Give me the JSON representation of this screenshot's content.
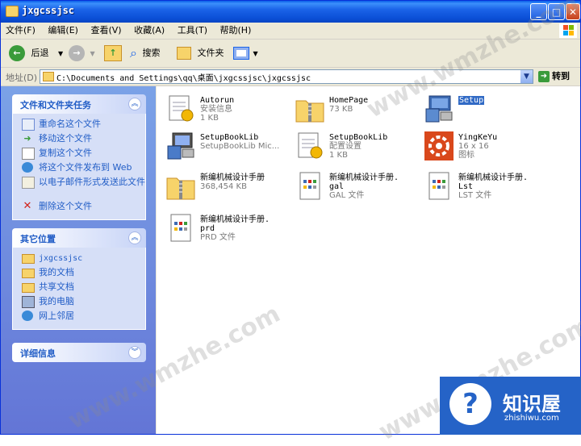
{
  "window": {
    "title": "jxgcssjsc",
    "controls": [
      "minimize",
      "maximize",
      "close"
    ]
  },
  "menu": [
    "文件(F)",
    "编辑(E)",
    "查看(V)",
    "收藏(A)",
    "工具(T)",
    "帮助(H)"
  ],
  "toolbar": {
    "back_label": "后退",
    "search_label": "搜索",
    "folders_label": "文件夹"
  },
  "address": {
    "label": "地址(D)",
    "value": "C:\\Documents and Settings\\qq\\桌面\\jxgcssjsc\\jxgcssjsc",
    "go_label": "转到"
  },
  "tasks": {
    "title": "文件和文件夹任务",
    "items": [
      "重命名这个文件",
      "移动这个文件",
      "复制这个文件",
      "将这个文件发布到 Web",
      "以电子邮件形式发送此文件",
      "删除这个文件"
    ]
  },
  "places": {
    "title": "其它位置",
    "items": [
      "jxgcssjsc",
      "我的文档",
      "共享文档",
      "我的电脑",
      "网上邻居"
    ]
  },
  "details": {
    "title": "详细信息"
  },
  "files": [
    {
      "name": "Autorun",
      "line2": "安装信息",
      "line3": "1 KB",
      "icon": "config-icon"
    },
    {
      "name": "HomePage",
      "line2": "73 KB",
      "icon": "zip-folder-icon"
    },
    {
      "name": "Setup",
      "icon": "installer-icon",
      "selected": true
    },
    {
      "name": "SetupBookLib",
      "line2": "SetupBookLib Mic...",
      "icon": "installer-icon"
    },
    {
      "name": "SetupBookLib",
      "line2": "配置设置",
      "line3": "1 KB",
      "icon": "config-icon"
    },
    {
      "name": "YingKeYu",
      "line2": "16 x 16",
      "line3": "图标",
      "icon": "gear-image-icon"
    },
    {
      "name": "新编机械设计手册",
      "line2": "368,454 KB",
      "icon": "zip-folder-icon"
    },
    {
      "name": "新编机械设计手册.",
      "name2": "gal",
      "line2": "GAL 文件",
      "icon": "document-icon"
    },
    {
      "name": "新编机械设计手册.",
      "name2": "Lst",
      "line2": "LST 文件",
      "icon": "document-icon"
    },
    {
      "name": "新编机械设计手册.",
      "name2": "prd",
      "line2": "PRD 文件",
      "icon": "document-icon"
    }
  ],
  "watermarks": [
    "www.wmzhe.com"
  ],
  "badge": {
    "glyph": "?",
    "title": "知识屋",
    "subtitle": "zhishiwu.com"
  }
}
